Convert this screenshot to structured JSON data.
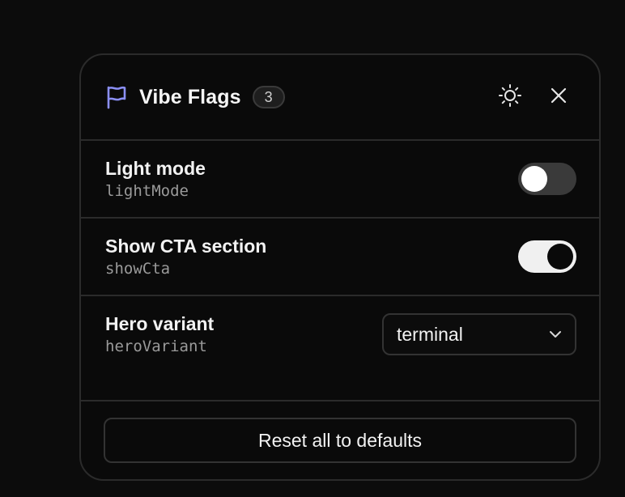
{
  "header": {
    "title": "Vibe Flags",
    "count": "3",
    "flag_icon": "flag-icon",
    "theme_icon": "sun-icon",
    "close_icon": "close-icon",
    "accent_color": "#8b8ff5"
  },
  "flags": [
    {
      "label": "Light mode",
      "key": "lightMode",
      "control": "toggle",
      "value": false
    },
    {
      "label": "Show CTA section",
      "key": "showCta",
      "control": "toggle",
      "value": true
    },
    {
      "label": "Hero variant",
      "key": "heroVariant",
      "control": "select",
      "value": "terminal"
    }
  ],
  "footer": {
    "reset_label": "Reset all to defaults"
  }
}
